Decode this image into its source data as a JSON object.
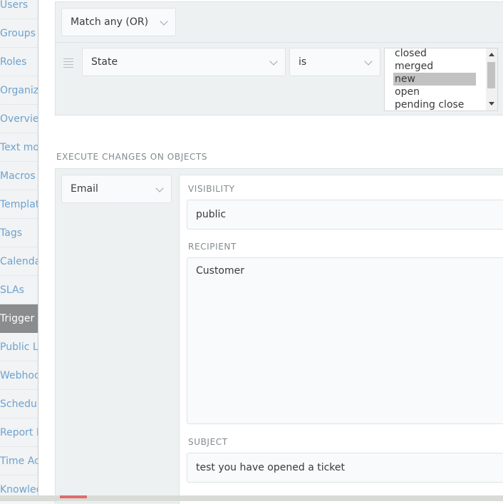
{
  "sidebar": {
    "items": [
      {
        "label": "Users",
        "active": false
      },
      {
        "label": "Groups",
        "active": false
      },
      {
        "label": "Roles",
        "active": false
      },
      {
        "label": "Organizations",
        "active": false
      },
      {
        "label": "Overviews",
        "active": false
      },
      {
        "label": "Text modules",
        "active": false
      },
      {
        "label": "Macros",
        "active": false
      },
      {
        "label": "Templates",
        "active": false
      },
      {
        "label": "Tags",
        "active": false
      },
      {
        "label": "Calendars",
        "active": false
      },
      {
        "label": "SLAs",
        "active": false
      },
      {
        "label": "Trigger",
        "active": true
      },
      {
        "label": "Public Links",
        "active": false
      },
      {
        "label": "Webhooks",
        "active": false
      },
      {
        "label": "Scheduler",
        "active": false
      },
      {
        "label": "Report Profiles",
        "active": false
      },
      {
        "label": "Time Accounting",
        "active": false
      },
      {
        "label": "Knowledge Base",
        "active": false
      }
    ]
  },
  "conditions": {
    "match_mode": "Match any (OR)",
    "row": {
      "attribute": "State",
      "operator": "is",
      "options": [
        "closed",
        "merged",
        "new",
        "open",
        "pending close"
      ],
      "selected": "new"
    }
  },
  "execute": {
    "section_title": "EXECUTE CHANGES ON OBJECTS",
    "action": "Email",
    "visibility_label": "VISIBILITY",
    "visibility_value": "public",
    "recipient_label": "RECIPIENT",
    "recipient_value": "Customer",
    "subject_label": "SUBJECT",
    "subject_value": "test you have opened a ticket"
  },
  "icons": {
    "drag_handle": "drag-handle-icon",
    "chevron": "chevron-down-icon"
  },
  "colors": {
    "link": "#6da2cf",
    "active_item_bg": "#8a8c8e",
    "selected_option_bg": "#c2c2c2"
  }
}
